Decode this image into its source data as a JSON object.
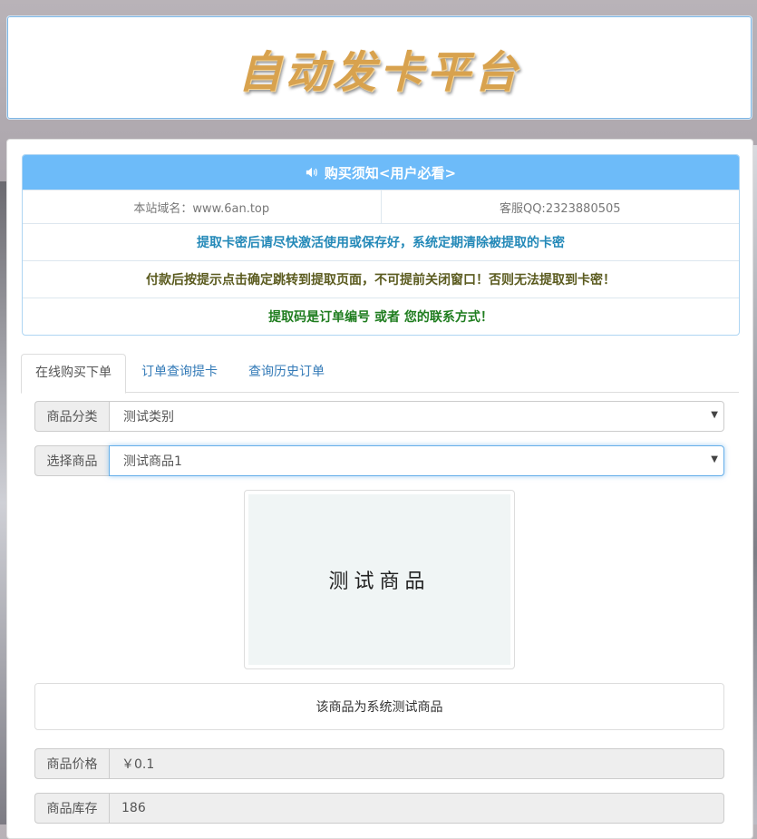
{
  "header": {
    "logo_text": "自动发卡平台"
  },
  "notice": {
    "title": "购买须知<用户必看>",
    "domain": "本站域名：www.6an.top",
    "qq": "客服QQ:2323880505",
    "line1": "提取卡密后请尽快激活使用或保存好，系统定期清除被提取的卡密",
    "line2": "付款后按提示点击确定跳转到提取页面，不可提前关闭窗口！否则无法提取到卡密！",
    "line3": "提取码是订单编号 或者 您的联系方式！",
    "colors": {
      "head": "#6dbbf9",
      "line1": "#2489b8",
      "line2": "#5b5b1f",
      "line3": "#1f7d1f"
    }
  },
  "tabs": [
    {
      "label": "在线购买下单"
    },
    {
      "label": "订单查询提卡"
    },
    {
      "label": "查询历史订单"
    }
  ],
  "form": {
    "category": {
      "label": "商品分类",
      "value": "测试类别"
    },
    "product": {
      "label": "选择商品",
      "value": "测试商品1"
    },
    "image_text": "测试商品",
    "description": "该商品为系统测试商品",
    "price": {
      "label": "商品价格",
      "value": "￥0.1"
    },
    "stock": {
      "label": "商品库存",
      "value": "186"
    }
  }
}
